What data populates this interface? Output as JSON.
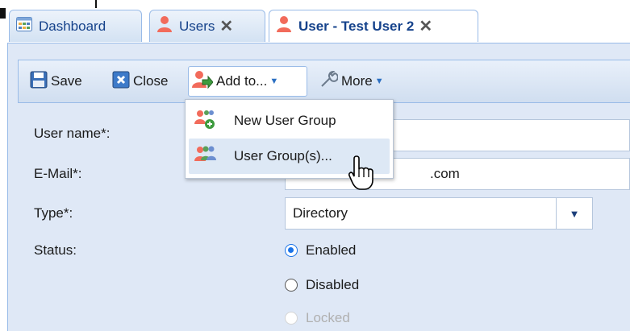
{
  "tabs": [
    {
      "label": "Dashboard",
      "icon": "dashboard-icon"
    },
    {
      "label": "Users",
      "icon": "user-icon"
    },
    {
      "label": "User - Test User 2",
      "icon": "user-icon"
    }
  ],
  "toolbar": {
    "save_label": "Save",
    "close_label": "Close",
    "add_label": "Add to...",
    "more_label": "More"
  },
  "menu": {
    "items": [
      {
        "label": "New User Group",
        "icon": "user-group-add-icon"
      },
      {
        "label": "User Group(s)...",
        "icon": "user-group-icon"
      }
    ]
  },
  "form": {
    "username_label": "User name*:",
    "email_label": "E-Mail*:",
    "email_value_visible": ".com",
    "type_label": "Type*:",
    "type_value": "Directory",
    "status_label": "Status:",
    "status_options": [
      "Enabled",
      "Disabled",
      "Locked"
    ],
    "status_selected": "Enabled"
  },
  "colors": {
    "tab_text": "#15428b",
    "panel_bg": "#dfe8f6",
    "border": "#99bbe8",
    "radio_selected": "#1a73e8",
    "user_icon": "#f26b5b"
  }
}
